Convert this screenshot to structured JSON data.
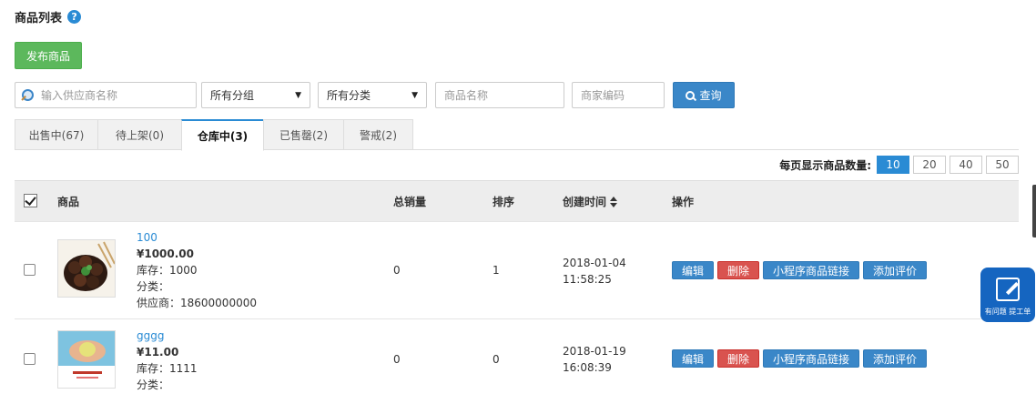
{
  "page": {
    "title": "商品列表",
    "help_icon": "?"
  },
  "toolbar": {
    "publish_label": "发布商品"
  },
  "filters": {
    "supplier_placeholder": "输入供应商名称",
    "group_value": "所有分组",
    "category_value": "所有分类",
    "name_placeholder": "商品名称",
    "code_placeholder": "商家编码",
    "search_label": "查询",
    "caret": "▼"
  },
  "tabs": [
    {
      "label": "出售中(67)"
    },
    {
      "label": "待上架(0)"
    },
    {
      "label": "仓库中(3)"
    },
    {
      "label": "已售罄(2)"
    },
    {
      "label": "警戒(2)"
    }
  ],
  "active_tab": 2,
  "pagesize": {
    "label": "每页显示商品数量:",
    "options": [
      "10",
      "20",
      "40",
      "50"
    ],
    "selected": "10"
  },
  "table": {
    "headers": {
      "product": "商品",
      "sales": "总销量",
      "order": "排序",
      "created": "创建时间",
      "actions": "操作"
    },
    "rows": [
      {
        "title": "100",
        "price": "¥1000.00",
        "stock": "库存：1000",
        "category": "分类：",
        "supplier": "供应商：18600000000",
        "sales": "0",
        "order": "1",
        "date": "2018-01-04",
        "time": "11:58:25"
      },
      {
        "title": "gggg",
        "price": "¥11.00",
        "stock": "库存：1111",
        "category": "分类：",
        "sales": "0",
        "order": "0",
        "date": "2018-01-19",
        "time": "16:08:39"
      }
    ],
    "action_labels": {
      "edit": "编辑",
      "delete": "删除",
      "miniapp_link": "小程序商品链接",
      "add_review": "添加评价"
    }
  },
  "float_widget": {
    "label": "有问题 提工单"
  },
  "colors": {
    "primary": "#3a87c8",
    "success": "#5cb85c",
    "danger": "#d9534f",
    "accent": "#2a8bd4"
  }
}
